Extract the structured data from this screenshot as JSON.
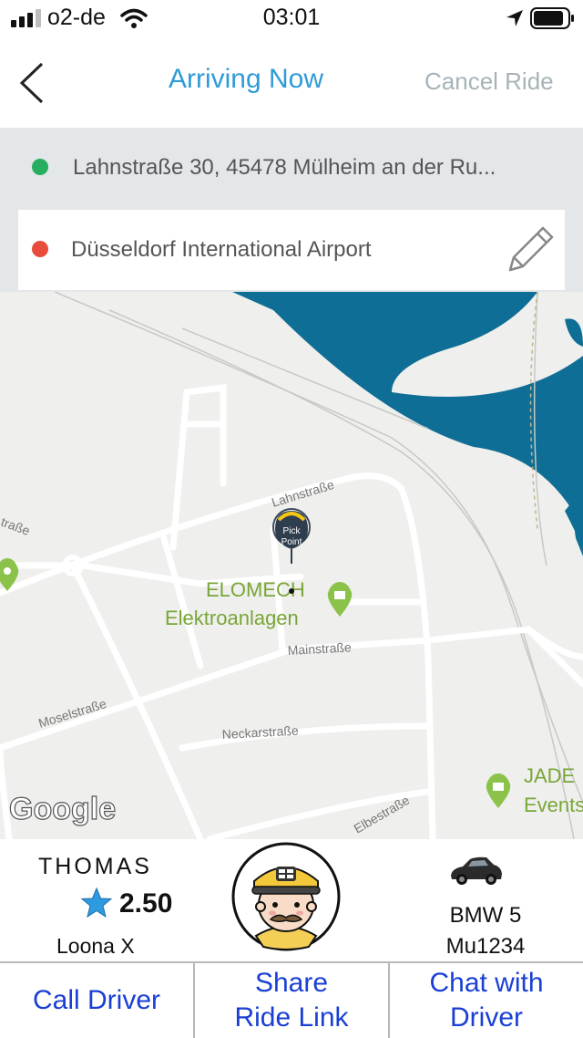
{
  "status_bar": {
    "carrier": "o2-de",
    "time": "03:01"
  },
  "nav": {
    "back_icon": "chevron-left-icon",
    "title": "Arriving Now",
    "cancel_label": "Cancel Ride"
  },
  "route": {
    "origin": "Lahnstraße 30, 45478 Mülheim an der Ru...",
    "destination": "Düsseldorf International Airport",
    "origin_color": "#27ae60",
    "destination_color": "#e74c3c",
    "edit_icon": "pencil-icon"
  },
  "map": {
    "streets": [
      "Lahnstraße",
      "Mainstraße",
      "Moselstraße",
      "Neckarstraße",
      "Elbestraße",
      "traße"
    ],
    "pin_label_line1": "Pick",
    "pin_label_line2": "Point",
    "poi1_line1": "ELOMECH",
    "poi1_line2": "Elektroanlagen",
    "poi2_line1": "JADE",
    "poi2_line2": "Events",
    "brand": "Google"
  },
  "driver": {
    "name": "THOMAS",
    "rating": "2.50",
    "service": "Loona X",
    "car_model": "BMW 5",
    "plate": "Mu1234"
  },
  "actions": {
    "call": "Call Driver",
    "share_line1": "Share",
    "share_line2": "Ride Link",
    "chat_line1": "Chat with",
    "chat_line2": "Driver"
  }
}
